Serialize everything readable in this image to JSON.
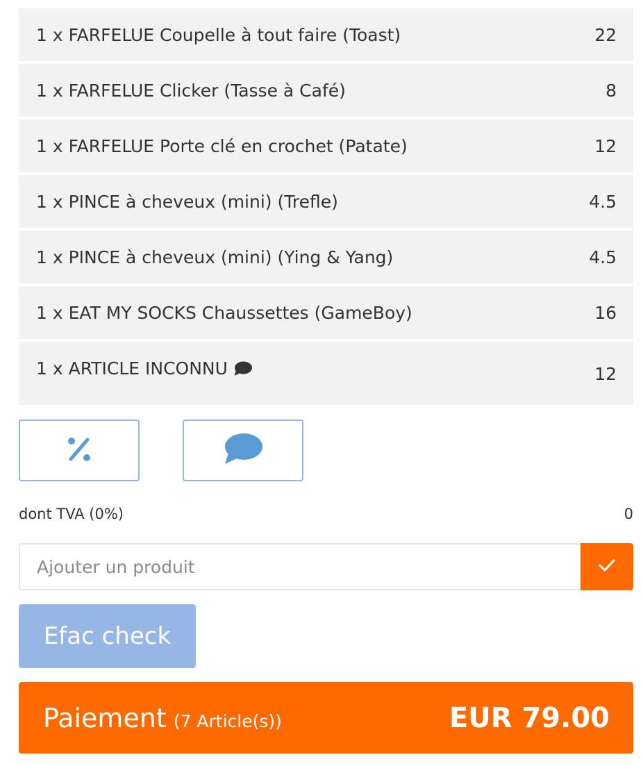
{
  "items": [
    {
      "label": "1 x FARFELUE Coupelle à tout faire (Toast)",
      "price": "22"
    },
    {
      "label": "1 x FARFELUE Clicker (Tasse à Café)",
      "price": "8"
    },
    {
      "label": "1 x FARFELUE Porte clé en crochet (Patate)",
      "price": "12"
    },
    {
      "label": "1 x PINCE à cheveux (mini) (Trefle)",
      "price": "4.5"
    },
    {
      "label": "1 x PINCE à cheveux (mini) (Ying & Yang)",
      "price": "4.5"
    },
    {
      "label": "1 x EAT MY SOCKS Chaussettes (GameBoy)",
      "price": "16"
    },
    {
      "label": "1 x ARTICLE INCONNU",
      "price": "12",
      "icon": "comment-icon"
    }
  ],
  "actions": {
    "discount_icon": "percent-icon",
    "comment_icon": "comment-icon"
  },
  "tax": {
    "label": "dont TVA (0%)",
    "value": "0"
  },
  "add_product": {
    "placeholder": "Ajouter un produit",
    "confirm_icon": "check-icon"
  },
  "efac_button": {
    "label": "Efac check"
  },
  "payment": {
    "label": "Paiement",
    "count": "(7 Article(s))",
    "total": "EUR 79.00"
  },
  "colors": {
    "accent": "#ff6a00",
    "secondary_button": "#96b7e6",
    "icon_blue": "#5b9bd5",
    "row_background": "#f2f2f2"
  }
}
